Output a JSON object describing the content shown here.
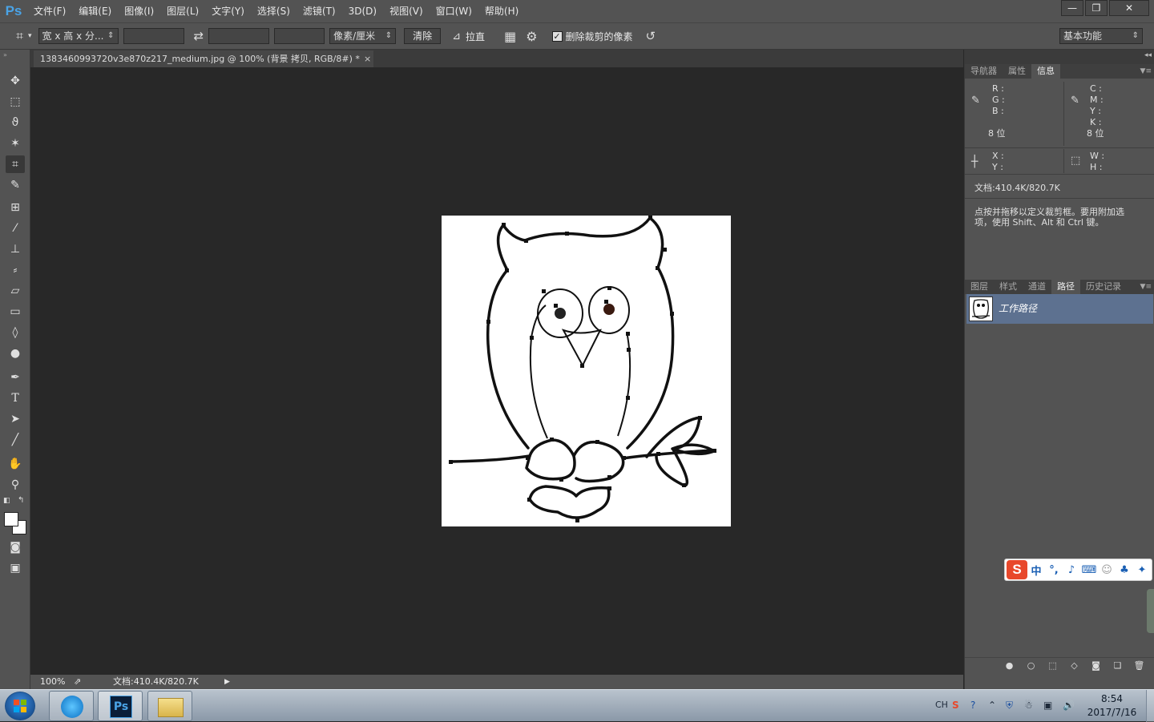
{
  "app": {
    "logo": "Ps"
  },
  "menubar": {
    "items": [
      "文件(F)",
      "编辑(E)",
      "图像(I)",
      "图层(L)",
      "文字(Y)",
      "选择(S)",
      "滤镜(T)",
      "3D(D)",
      "视图(V)",
      "窗口(W)",
      "帮助(H)"
    ],
    "window_controls": {
      "minimize": "—",
      "restore": "❐",
      "close": "✕"
    }
  },
  "options": {
    "ratio_select": "宽 x 高 x 分...",
    "width_value": "",
    "height_value": "",
    "resolution_value": "",
    "unit_select": "像素/厘米",
    "clear_button": "清除",
    "straighten_label": "拉直",
    "delete_cropped_label": "删除裁剪的像素",
    "delete_cropped_checked": true,
    "workspace_select": "基本功能"
  },
  "document": {
    "tab_title": "1383460993720v3e870z217_medium.jpg @ 100% (背景 拷贝, RGB/8#) *",
    "tab_close": "×"
  },
  "status": {
    "zoom": "100%",
    "doc_size": "文档:410.4K/820.7K",
    "arrow": "▶"
  },
  "info_panel": {
    "tabs": [
      "导航器",
      "属性",
      "信息"
    ],
    "active_tab": "信息",
    "rgb_labels": "R :\nG :\nB :",
    "cmyk_labels": "C :\nM :\nY :\nK :",
    "bits_left": "8 位",
    "bits_right": "8 位",
    "xy_labels": "X :\nY :",
    "wh_labels": "W :\nH :",
    "doc_size": "文档:410.4K/820.7K",
    "hint": "点按并拖移以定义裁剪框。要用附加选\n项，使用 Shift、Alt 和 Ctrl 键。"
  },
  "paths_panel": {
    "tabs": [
      "图层",
      "样式",
      "通道",
      "路径",
      "历史记录"
    ],
    "active_tab": "路径",
    "work_path_name": "工作路径"
  },
  "ime_bar": {
    "logo": "S",
    "lang": "中"
  },
  "taskbar": {
    "tray_lang": "CH",
    "time": "8:54",
    "date": "2017/7/16"
  },
  "colors": {
    "accent_ps": "#4aa3e6",
    "selection_row": "#5d7190",
    "canvas_bg": "#282828"
  }
}
